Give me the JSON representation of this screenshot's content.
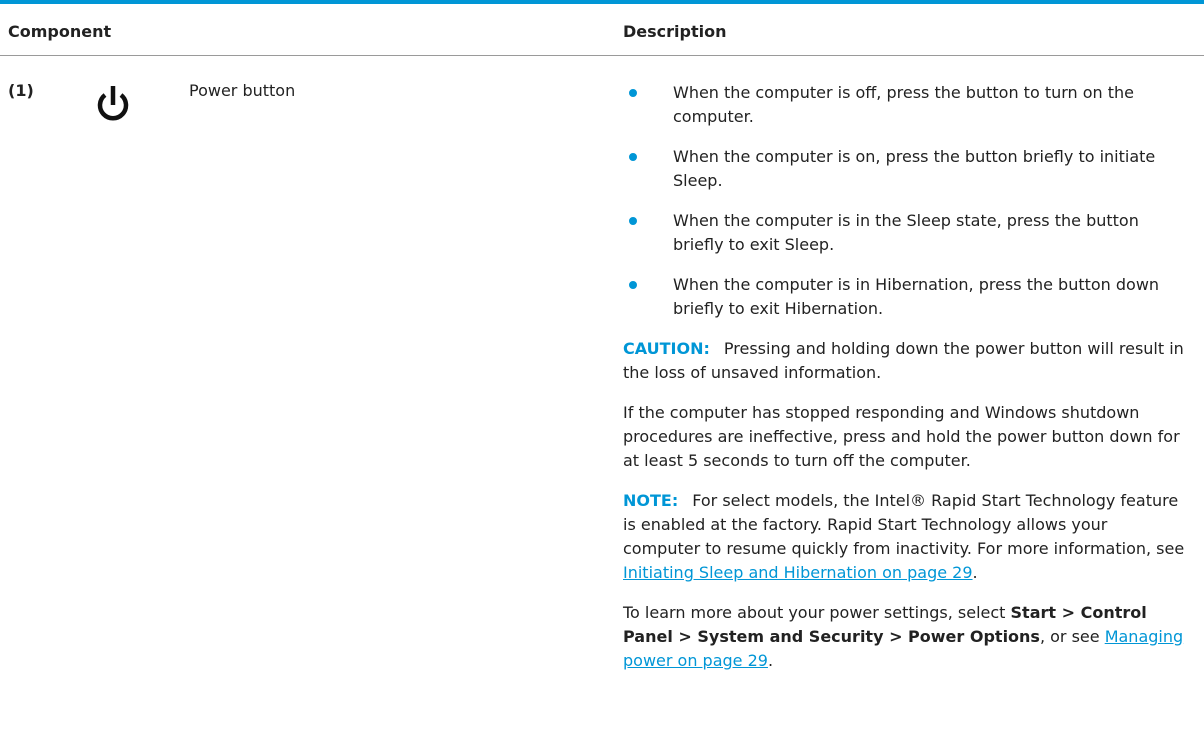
{
  "table": {
    "headers": {
      "component": "Component",
      "description": "Description"
    },
    "row": {
      "number": "(1)",
      "icon": "power-icon",
      "name": "Power button",
      "bullets": [
        "When the computer is off, press the button to turn on the computer.",
        "When the computer is on, press the button briefly to initiate Sleep.",
        "When the computer is in the Sleep state, press the button briefly to exit Sleep.",
        "When the computer is in Hibernation, press the button down briefly to exit Hibernation."
      ],
      "caution": {
        "label": "CAUTION:",
        "text": "Pressing and holding down the power button will result in the loss of unsaved information."
      },
      "shutdown_text": "If the computer has stopped responding and Windows shutdown procedures are ineffective, press and hold the power button down for at least 5 seconds to turn off the computer.",
      "note": {
        "label": "NOTE:",
        "text": "For select models, the Intel® Rapid Start Technology feature is enabled at the factory. Rapid Start Technology allows your computer to resume quickly from inactivity. For more information, see ",
        "link": "Initiating Sleep and Hibernation on page 29",
        "end": "."
      },
      "settings": {
        "prefix": "To learn more about your power settings, select ",
        "path": "Start > Control Panel > System and Security > Power Options",
        "middle": ", or see ",
        "link": "Managing power on page 29",
        "end": "."
      }
    }
  },
  "colors": {
    "accent": "#0096d6",
    "text": "#222222",
    "rule": "#9a9a9a"
  }
}
